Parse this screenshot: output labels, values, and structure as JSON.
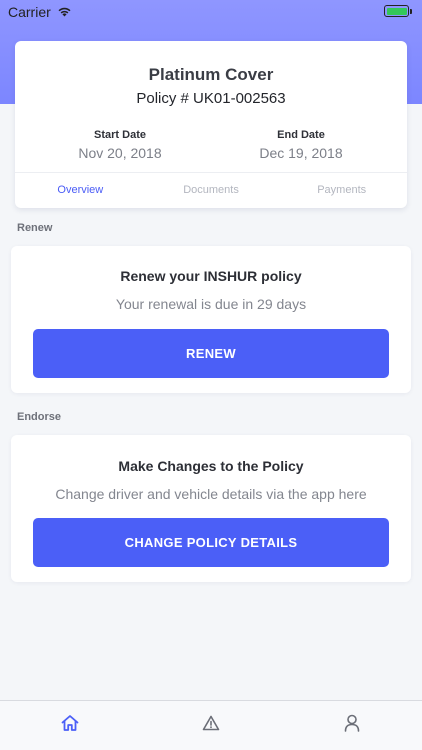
{
  "status_bar": {
    "carrier": "Carrier",
    "battery_color": "#34c759"
  },
  "theme": {
    "accent": "#4b5ff7",
    "hero_gradient": "#8f96ff"
  },
  "policy": {
    "title": "Platinum Cover",
    "number": "Policy # UK01-002563",
    "start_label": "Start Date",
    "start_value": "Nov 20, 2018",
    "end_label": "End Date",
    "end_value": "Dec 19, 2018",
    "tabs": [
      {
        "label": "Overview",
        "active": true
      },
      {
        "label": "Documents",
        "active": false
      },
      {
        "label": "Payments",
        "active": false
      }
    ]
  },
  "renew": {
    "section_label": "Renew",
    "title": "Renew your INSHUR policy",
    "subtitle": "Your renewal is due in 29 days",
    "button": "RENEW"
  },
  "endorse": {
    "section_label": "Endorse",
    "title": "Make Changes to the Policy",
    "subtitle": "Change driver and vehicle details via the app here",
    "button": "CHANGE POLICY DETAILS"
  },
  "tab_bar": {
    "items": [
      {
        "icon": "home-icon",
        "active": true
      },
      {
        "icon": "warning-icon",
        "active": false
      },
      {
        "icon": "profile-icon",
        "active": false
      }
    ]
  }
}
